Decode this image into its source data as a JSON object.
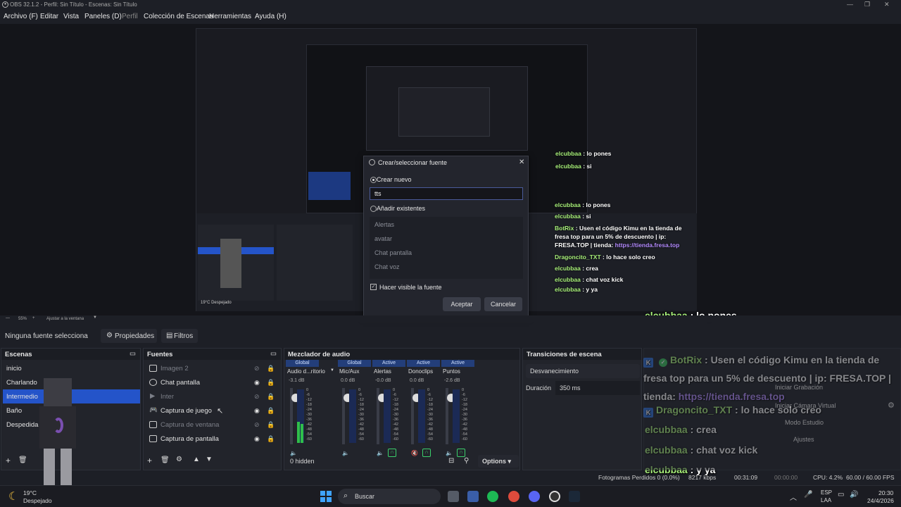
{
  "window": {
    "title": "OBS 32.1.2 - Perfil: Sin Título - Escenas: Sin Título"
  },
  "menu": [
    "Archivo (F)",
    "Editar",
    "Vista",
    "Paneles (D)",
    "Perfil",
    "Colección de Escenas",
    "Herramientas",
    "Ayuda (H)"
  ],
  "dialog": {
    "title": "Crear/seleccionar fuente",
    "create_new": "Crear nuevo",
    "name_value": "tts",
    "add_existing": "Añadir existentes",
    "existing": [
      "Alertas",
      "avatar",
      "Chat pantalla",
      "Chat voz"
    ],
    "visible_label": "Hacer visible la fuente",
    "ok": "Aceptar",
    "cancel": "Cancelar"
  },
  "preview_ctrl": {
    "zoom": "55%",
    "fit": "Ajustar a la ventana"
  },
  "propbar": {
    "no_source": "Ninguna fuente selecciona",
    "properties": "Propiedades",
    "filters": "Filtros"
  },
  "scenes": {
    "title": "Escenas",
    "items": [
      "inicio",
      "Charlando",
      "Intermedio",
      "Baño",
      "Despedida"
    ],
    "selected": 2
  },
  "sources": {
    "title": "Fuentes",
    "items": [
      {
        "name": "Imagen 2",
        "visible": false
      },
      {
        "name": "Chat pantalla",
        "visible": true
      },
      {
        "name": "Inter",
        "visible": false
      },
      {
        "name": "Captura de juego",
        "visible": true
      },
      {
        "name": "Captura de ventana",
        "visible": false
      },
      {
        "name": "Captura de pantalla",
        "visible": true
      }
    ]
  },
  "mixer": {
    "title": "Mezclador de audio",
    "hidden": "0 hidden",
    "options": "Options",
    "channels": [
      {
        "head": "Global",
        "name": "Audio d...ritorio",
        "db": "-3.1 dB"
      },
      {
        "head": "Global",
        "name": "Mic/Aux",
        "db": "0.0 dB"
      },
      {
        "head": "Active",
        "name": "Alertas",
        "db": "-0.0 dB"
      },
      {
        "head": "Active",
        "name": "Donoclips",
        "db": "0.0 dB"
      },
      {
        "head": "Active",
        "name": "Puntos",
        "db": "-2.6 dB"
      }
    ],
    "ticks": [
      "0",
      "-6",
      "-12",
      "-18",
      "-24",
      "-30",
      "-36",
      "-42",
      "-48",
      "-54",
      "-60"
    ]
  },
  "transitions": {
    "title": "Transiciones de escena",
    "type": "Desvanecimiento",
    "duration_label": "Duración",
    "duration": "350 ms"
  },
  "controls": {
    "rec": "Iniciar Grabación",
    "vcam": "Iniciar Cámara Virtual",
    "studio": "Modo Estudio",
    "settings": "Ajustes"
  },
  "chat": [
    {
      "user": "elcubbaa",
      "msg": " : lo pones"
    },
    {
      "user": "elcubbaa",
      "msg": " : si"
    },
    {
      "user": "BotRix",
      "msg": " : Usen el código Kimu en la tienda de fresa top para un 5% de descuento | ip: FRESA.TOP | tienda: ",
      "link": "https://tienda.fresa.top"
    },
    {
      "user": "Dragoncito_TXT",
      "msg": " : lo hace solo creo"
    },
    {
      "user": "elcubbaa",
      "msg": " : crea"
    },
    {
      "user": "elcubbaa",
      "msg": " : chat voz kick"
    },
    {
      "user": "elcubbaa",
      "msg": " : y ya"
    }
  ],
  "status": {
    "dropped": "Fotogramas Perdidos 0 (0.0%)",
    "kbps": "8217 kbps",
    "live": "00:31:09",
    "rec": "00:00:00",
    "cpu": "CPU: 4.2%",
    "fps": "60.00 / 60.00 FPS"
  },
  "weather": {
    "temp": "19°C",
    "desc": "Despejado"
  },
  "taskbar": {
    "search": "Buscar",
    "lang1": "ESP",
    "lang2": "LAA",
    "time": "20:30",
    "date": "24/4/2026"
  },
  "nested_weather": {
    "temp": "19°C",
    "desc": "Despejado"
  }
}
